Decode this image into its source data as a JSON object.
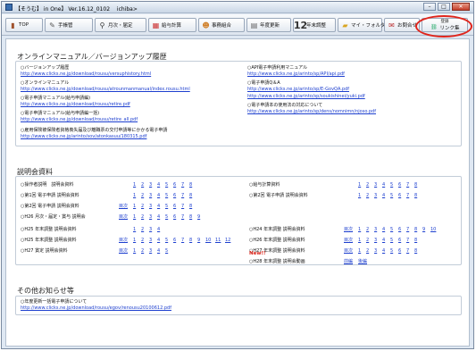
{
  "window": {
    "title": "【そうむ】 in One】 Ver.16.12_0102 　ichiba>"
  },
  "toolbar": {
    "top": "TOP",
    "notebook": "手帳管",
    "register": "月次・届定",
    "payroll": "給与計算",
    "office": "事務組合",
    "year_change": "年度更新",
    "year_end": "年末調整",
    "my_folder": "マイ・フォルダー",
    "customer": "お問合せ",
    "links_top": "登録",
    "links": "リンク集"
  },
  "sections": {
    "online_manual": "オンラインマニュアル／バージョンアップ履歴",
    "seminar": "説明会資料",
    "other": "その他お知らせ等"
  },
  "manual": [
    {
      "title": "○バージョンアップ履歴",
      "url": "http://www.clicks.ne.jp/download/rousu/versuphistory.html"
    },
    {
      "title": "○オンラインマニュアル",
      "url": "http://www.clicks.ne.jp/download/rousu/atrounmanmanual/index.rousu.html"
    },
    {
      "title": "○電子申請マニュアル(給与申請編)",
      "url": "http://www.clicks.ne.jp/download/rousu/retire.pdf"
    },
    {
      "title": "○電子申請マニュアル(給与申請編一括)",
      "url": "http://www.clicks.ne.jp/download/rousu/retire_all.pdf"
    },
    {
      "title": "○雇用保険被保険者資格喪失届及び離職票の交付申請等にかかる電子申請",
      "url": "http://www.clicks.ne.jp/arinto/sov/atonkasuu/180315.pdf"
    },
    {
      "title": "○API電子申請利用マニュアル",
      "url": "http://www.clicks.ne.jp/arinto/sp/API/api.pdf"
    },
    {
      "title": "○電子申請Q＆A",
      "url": "http://www.clicks.ne.jp/arinto/sp/E-GovQA.pdf"
    },
    {
      "title": "",
      "url": "http://www.clicks.ne.jp/arinto/sp/soukishinei/yuki.pdf"
    },
    {
      "title": "○電子申請本の使用法の対応について",
      "url": "http://www.clicks.ne.jp/arinto/sp/dens/nomnimn/njoso.pdf"
    }
  ],
  "seminar_left": [
    {
      "label": "○操作者説明　説明会資料",
      "idx": "",
      "nums": [
        "1",
        "2",
        "3",
        "4",
        "5",
        "6",
        "7",
        "8"
      ]
    },
    {
      "label": "○第1回 電子申請 説明会資料",
      "idx": "",
      "nums": [
        "1",
        "2",
        "3",
        "4",
        "5",
        "6",
        "7",
        "8"
      ]
    },
    {
      "label": "○第2回 電子申請 説明会資料",
      "idx": "目次",
      "nums": [
        "1",
        "2",
        "3",
        "4",
        "5",
        "6",
        "7",
        "8"
      ]
    },
    {
      "label": "○H26 月次・届定・賞与 説明会",
      "idx": "目次",
      "nums": [
        "1",
        "2",
        "3",
        "4",
        "5",
        "6",
        "7",
        "8",
        "9"
      ]
    },
    {
      "label": "○H25 年末調整 説明会資料",
      "idx": "",
      "nums": [
        "1",
        "2",
        "3",
        "4"
      ]
    },
    {
      "label": "○H25 年末調整 説明会資料",
      "idx": "目次",
      "nums": [
        "1",
        "2",
        "3",
        "4",
        "5",
        "6",
        "7",
        "8",
        "9",
        "10",
        "11",
        "12"
      ]
    },
    {
      "label": "○H27 賞定 説明会資料",
      "idx": "目次",
      "nums": [
        "1",
        "2",
        "3",
        "4",
        "5"
      ]
    }
  ],
  "seminar_right": [
    {
      "label": "○給与計算資料",
      "idx": "",
      "nums": [
        "1",
        "2",
        "3",
        "4",
        "5",
        "6",
        "7",
        "8"
      ]
    },
    {
      "label": "○第2回 電子申請 説明会資料",
      "idx": "",
      "nums": [
        "1",
        "2",
        "3",
        "4",
        "5",
        "6",
        "7",
        "8"
      ]
    },
    {
      "label": "○H24 年末調整 説明会資料",
      "idx": "目次",
      "nums": [
        "1",
        "2",
        "3",
        "4",
        "5",
        "6",
        "7",
        "8",
        "9",
        "10"
      ]
    },
    {
      "label": "○H26 年末調整 説明会資料",
      "idx": "目次",
      "nums": [
        "1",
        "2",
        "3",
        "4",
        "5",
        "6",
        "7",
        "8"
      ]
    },
    {
      "label": "○H27 年末調整 説明会資料",
      "idx": "目次",
      "nums": [
        "1",
        "2",
        "3",
        "4",
        "5",
        "6",
        "7",
        "8"
      ]
    },
    {
      "label": "○H28 年末調整 説明会動画",
      "idx": "前編",
      "idx2": "後編",
      "nums": []
    }
  ],
  "new_badge": "New!!",
  "other": [
    {
      "title": "○年度更新一括電子申請について",
      "url": "http://www.clicks.ne.jp/download/rousu/egov/renousu20100612.pdf"
    }
  ]
}
